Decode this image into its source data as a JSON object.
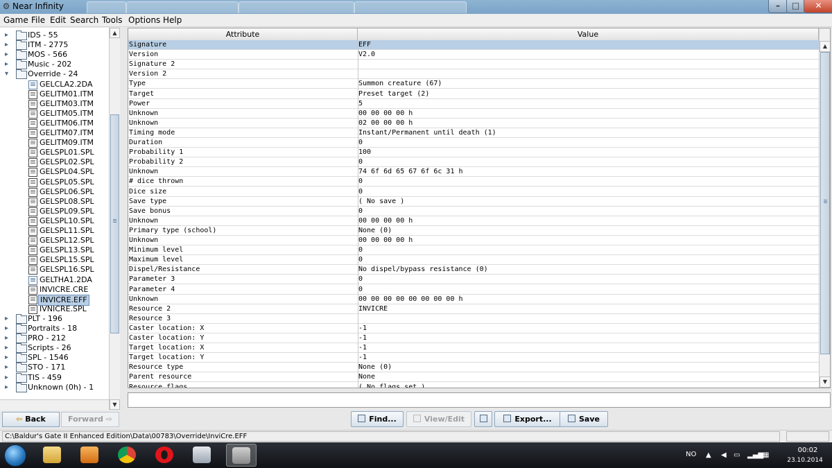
{
  "window": {
    "title": "Near Infinity"
  },
  "menu": [
    "Game",
    "File",
    "Edit",
    "Search",
    "Tools",
    "Options",
    "Help"
  ],
  "tree": {
    "items": [
      {
        "label": "IDS - 55",
        "kind": "folder",
        "level": 0
      },
      {
        "label": "ITM - 2775",
        "kind": "folder",
        "level": 0
      },
      {
        "label": "MOS - 566",
        "kind": "folder",
        "level": 0
      },
      {
        "label": "Music - 202",
        "kind": "folder",
        "level": 0
      },
      {
        "label": "Override - 24",
        "kind": "folder",
        "level": 0,
        "expanded": true
      },
      {
        "label": "GELCLA2.2DA",
        "kind": "doc",
        "level": 1
      },
      {
        "label": "GELITM01.ITM",
        "kind": "file",
        "level": 1
      },
      {
        "label": "GELITM03.ITM",
        "kind": "file",
        "level": 1
      },
      {
        "label": "GELITM05.ITM",
        "kind": "file",
        "level": 1
      },
      {
        "label": "GELITM06.ITM",
        "kind": "file",
        "level": 1
      },
      {
        "label": "GELITM07.ITM",
        "kind": "file",
        "level": 1
      },
      {
        "label": "GELITM09.ITM",
        "kind": "file",
        "level": 1
      },
      {
        "label": "GELSPL01.SPL",
        "kind": "file",
        "level": 1
      },
      {
        "label": "GELSPL02.SPL",
        "kind": "file",
        "level": 1
      },
      {
        "label": "GELSPL04.SPL",
        "kind": "file",
        "level": 1
      },
      {
        "label": "GELSPL05.SPL",
        "kind": "file",
        "level": 1
      },
      {
        "label": "GELSPL06.SPL",
        "kind": "file",
        "level": 1
      },
      {
        "label": "GELSPL08.SPL",
        "kind": "file",
        "level": 1
      },
      {
        "label": "GELSPL09.SPL",
        "kind": "file",
        "level": 1
      },
      {
        "label": "GELSPL10.SPL",
        "kind": "file",
        "level": 1
      },
      {
        "label": "GELSPL11.SPL",
        "kind": "file",
        "level": 1
      },
      {
        "label": "GELSPL12.SPL",
        "kind": "file",
        "level": 1
      },
      {
        "label": "GELSPL13.SPL",
        "kind": "file",
        "level": 1
      },
      {
        "label": "GELSPL15.SPL",
        "kind": "file",
        "level": 1
      },
      {
        "label": "GELSPL16.SPL",
        "kind": "file",
        "level": 1
      },
      {
        "label": "GELTHA1.2DA",
        "kind": "doc",
        "level": 1
      },
      {
        "label": "INVICRE.CRE",
        "kind": "file",
        "level": 1
      },
      {
        "label": "INVICRE.EFF",
        "kind": "file",
        "level": 1,
        "selected": true
      },
      {
        "label": "IVNICRE.SPL",
        "kind": "file",
        "level": 1
      },
      {
        "label": "PLT - 196",
        "kind": "folder",
        "level": 0
      },
      {
        "label": "Portraits - 18",
        "kind": "folder",
        "level": 0
      },
      {
        "label": "PRO - 212",
        "kind": "folder",
        "level": 0
      },
      {
        "label": "Scripts - 26",
        "kind": "folder",
        "level": 0
      },
      {
        "label": "SPL - 1546",
        "kind": "folder",
        "level": 0
      },
      {
        "label": "STO - 171",
        "kind": "folder",
        "level": 0
      },
      {
        "label": "TIS - 459",
        "kind": "folder",
        "level": 0
      },
      {
        "label": "Unknown (0h) - 1",
        "kind": "folder",
        "level": 0
      }
    ]
  },
  "nav": {
    "back": "Back",
    "forward": "Forward"
  },
  "table": {
    "headers": {
      "attribute": "Attribute",
      "value": "Value"
    },
    "rows": [
      {
        "a": "Signature",
        "v": "EFF",
        "selected": true
      },
      {
        "a": "Version",
        "v": "V2.0"
      },
      {
        "a": "Signature 2",
        "v": ""
      },
      {
        "a": "Version 2",
        "v": ""
      },
      {
        "a": "Type",
        "v": "Summon creature (67)"
      },
      {
        "a": "Target",
        "v": "Preset target (2)"
      },
      {
        "a": "Power",
        "v": "5"
      },
      {
        "a": "Unknown",
        "v": "00 00 00 00 h"
      },
      {
        "a": "Unknown",
        "v": "02 00 00 00 h"
      },
      {
        "a": "Timing mode",
        "v": "Instant/Permanent until death (1)"
      },
      {
        "a": "Duration",
        "v": "0"
      },
      {
        "a": "Probability 1",
        "v": "100"
      },
      {
        "a": "Probability 2",
        "v": "0"
      },
      {
        "a": "Unknown",
        "v": "74 6f 6d 65 67 6f 6c 31 h"
      },
      {
        "a": "# dice thrown",
        "v": "0"
      },
      {
        "a": "Dice size",
        "v": "0"
      },
      {
        "a": "Save type",
        "v": "( No save )"
      },
      {
        "a": "Save bonus",
        "v": "0"
      },
      {
        "a": "Unknown",
        "v": "00 00 00 00 h"
      },
      {
        "a": "Primary type (school)",
        "v": "None (0)"
      },
      {
        "a": "Unknown",
        "v": "00 00 00 00 h"
      },
      {
        "a": "Minimum level",
        "v": "0"
      },
      {
        "a": "Maximum level",
        "v": "0"
      },
      {
        "a": "Dispel/Resistance",
        "v": "No dispel/bypass resistance (0)"
      },
      {
        "a": "Parameter 3",
        "v": "0"
      },
      {
        "a": "Parameter 4",
        "v": "0"
      },
      {
        "a": "Unknown",
        "v": "00 00 00 00 00 00 00 00 h"
      },
      {
        "a": "Resource 2",
        "v": "INVICRE"
      },
      {
        "a": "Resource 3",
        "v": ""
      },
      {
        "a": "Caster location: X",
        "v": "-1"
      },
      {
        "a": "Caster location: Y",
        "v": "-1"
      },
      {
        "a": "Target location: X",
        "v": "-1"
      },
      {
        "a": "Target location: Y",
        "v": "-1"
      },
      {
        "a": "Resource type",
        "v": "None (0)"
      },
      {
        "a": "Parent resource",
        "v": "None"
      },
      {
        "a": "Resource flags",
        "v": "( No flags set )"
      }
    ]
  },
  "actions": {
    "find": "Find...",
    "view_edit": "View/Edit",
    "export": "Export...",
    "save": "Save"
  },
  "status": {
    "path": "C:\\Baldur's Gate II Enhanced Edition\\Data\\00783\\Override\\InviCre.EFF"
  },
  "taskbar": {
    "apps": [
      "explorer-icon",
      "media-player-icon",
      "chrome-icon",
      "opera-icon",
      "calculator-icon",
      "near-infinity-icon"
    ],
    "language": "NO",
    "time": "00:02",
    "date": "23.10.2014"
  }
}
